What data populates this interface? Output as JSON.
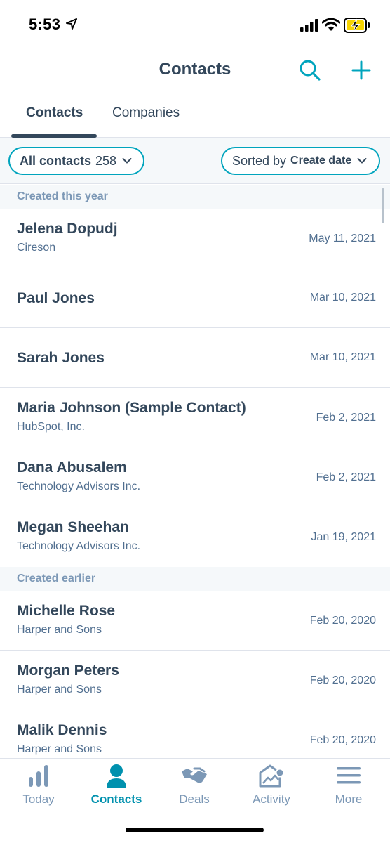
{
  "status_bar": {
    "time": "5:53",
    "icons": [
      "location-arrow-icon",
      "cellular-signal-icon",
      "wifi-icon",
      "battery-charging-icon"
    ]
  },
  "header": {
    "title": "Contacts",
    "icons": [
      "search-icon",
      "plus-icon"
    ]
  },
  "colors": {
    "accent": "#00a4bd",
    "active_nav": "#0091ae",
    "text_dark": "#33475b",
    "text_muted": "#516f90",
    "section_text": "#7c98b6"
  },
  "tabs": [
    {
      "label": "Contacts",
      "active": true
    },
    {
      "label": "Companies",
      "active": false
    }
  ],
  "filter": {
    "label": "All contacts",
    "count": "258",
    "sort_prefix": "Sorted by",
    "sort_field": "Create date"
  },
  "sections": [
    {
      "title": "Created this year",
      "rows": [
        {
          "name": "Jelena Dopudj",
          "company": "Cireson",
          "date": "May 11, 2021"
        },
        {
          "name": "Paul Jones",
          "company": "",
          "date": "Mar 10, 2021"
        },
        {
          "name": "Sarah Jones",
          "company": "",
          "date": "Mar 10, 2021"
        },
        {
          "name": "Maria Johnson (Sample Contact)",
          "company": "HubSpot, Inc.",
          "date": "Feb 2, 2021"
        },
        {
          "name": "Dana Abusalem",
          "company": "Technology Advisors Inc.",
          "date": "Feb 2, 2021"
        },
        {
          "name": "Megan Sheehan",
          "company": "Technology Advisors Inc.",
          "date": "Jan 19, 2021"
        }
      ]
    },
    {
      "title": "Created earlier",
      "rows": [
        {
          "name": "Michelle Rose",
          "company": "Harper and Sons",
          "date": "Feb 20, 2020"
        },
        {
          "name": "Morgan Peters",
          "company": "Harper and Sons",
          "date": "Feb 20, 2020"
        },
        {
          "name": "Malik Dennis",
          "company": "Harper and Sons",
          "date": "Feb 20, 2020"
        }
      ]
    }
  ],
  "bottom_nav": [
    {
      "label": "Today",
      "icon": "bar-chart-icon",
      "active": false
    },
    {
      "label": "Contacts",
      "icon": "person-icon",
      "active": true
    },
    {
      "label": "Deals",
      "icon": "handshake-icon",
      "active": false
    },
    {
      "label": "Activity",
      "icon": "activity-envelope-icon",
      "active": false
    },
    {
      "label": "More",
      "icon": "hamburger-menu-icon",
      "active": false
    }
  ]
}
